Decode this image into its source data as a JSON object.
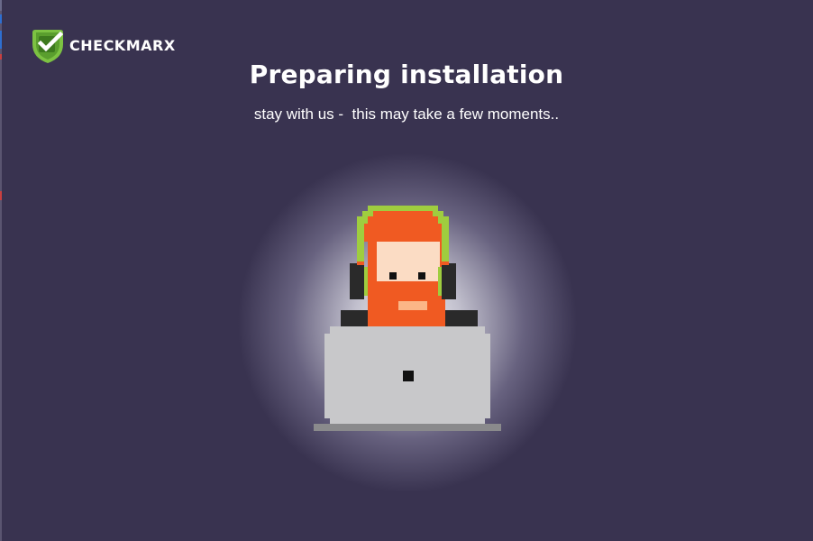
{
  "brand": {
    "name": "CHECKMARX",
    "logo_icon": "checkmark-shield-icon",
    "logo_color": "#6cc24a"
  },
  "main": {
    "title": "Preparing installation",
    "subtitle": "stay with us -  this may take a few moments.."
  },
  "illustration": {
    "icon": "developer-with-headphones-at-laptop-icon"
  },
  "colors": {
    "background": "#393350",
    "text": "#ffffff",
    "beard": "#f05a22",
    "skin": "#fbdcc4",
    "headphones": "#9fcd3f",
    "laptop": "#c8c8ca"
  }
}
